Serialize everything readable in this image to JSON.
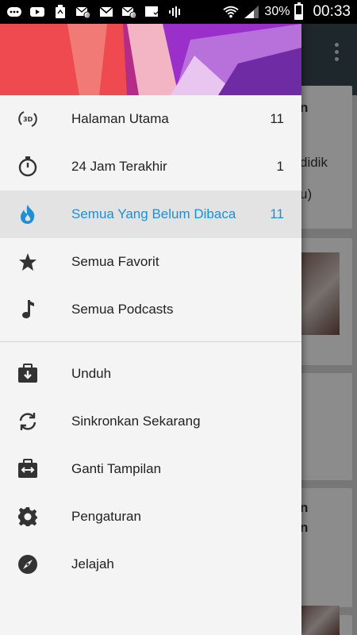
{
  "status_bar": {
    "battery": "30%",
    "battery_level": 0.3,
    "time": "00:33",
    "icons": [
      "chat-icon",
      "youtube-icon",
      "recycle-icon",
      "email-icon",
      "gmail-icon",
      "email-icon",
      "store-icon",
      "sound-icon",
      "wifi-icon",
      "signal-icon",
      "battery-icon"
    ]
  },
  "drawer": {
    "items": [
      {
        "label": "Halaman Utama",
        "count": "11",
        "icon": "3d-rotate-icon"
      },
      {
        "label": "24 Jam Terakhir",
        "count": "1",
        "icon": "stopwatch-icon"
      },
      {
        "label": "Semua Yang Belum Dibaca",
        "count": "11",
        "icon": "flame-icon",
        "active": true
      },
      {
        "label": "Semua Favorit",
        "count": "",
        "icon": "star-icon"
      },
      {
        "label": "Semua Podcasts",
        "count": "",
        "icon": "music-note-icon"
      }
    ],
    "actions": [
      {
        "label": "Unduh",
        "icon": "download-icon"
      },
      {
        "label": "Sinkronkan Sekarang",
        "icon": "sync-icon"
      },
      {
        "label": "Ganti Tampilan",
        "icon": "switch-view-icon"
      },
      {
        "label": "Pengaturan",
        "icon": "gear-icon"
      },
      {
        "label": "Jelajah",
        "icon": "compass-icon"
      }
    ],
    "accent_color": "#1e8fd6"
  },
  "background": {
    "snippets": [
      "n",
      "didik",
      "u)",
      "n",
      "n"
    ]
  }
}
